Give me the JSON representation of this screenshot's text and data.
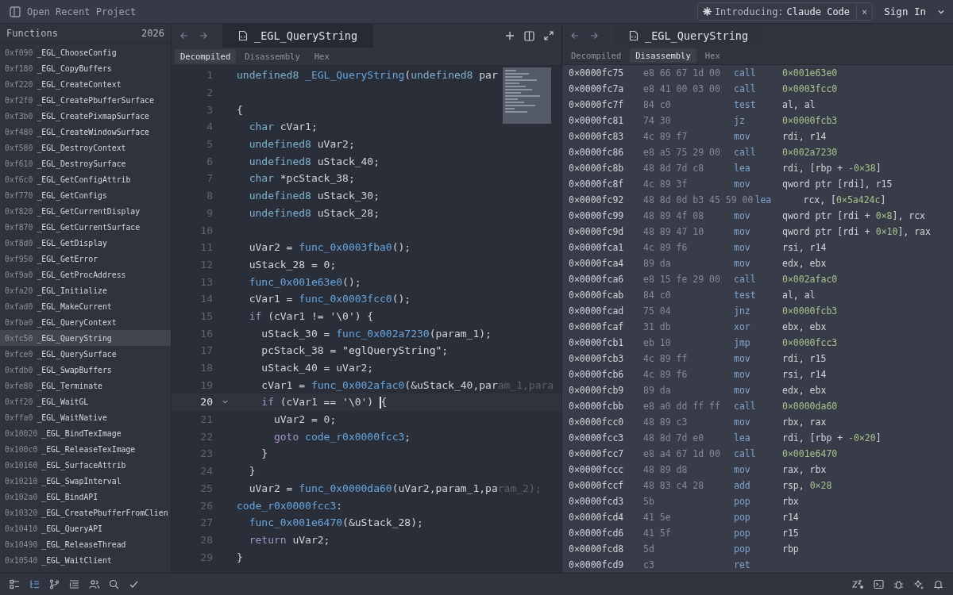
{
  "top_bar": {
    "title": "Open Recent Project",
    "banner": {
      "prefix": "Introducing:",
      "name": "Claude Code",
      "close": "×"
    },
    "sign_in": "Sign In"
  },
  "sidebar": {
    "title": "Functions",
    "count": "2026",
    "items": [
      {
        "address": "0xf090",
        "name": "_EGL_ChooseConfig",
        "selected": false
      },
      {
        "address": "0xf180",
        "name": "_EGL_CopyBuffers",
        "selected": false
      },
      {
        "address": "0xf220",
        "name": "_EGL_CreateContext",
        "selected": false
      },
      {
        "address": "0xf2f0",
        "name": "_EGL_CreatePbufferSurface",
        "selected": false
      },
      {
        "address": "0xf3b0",
        "name": "_EGL_CreatePixmapSurface",
        "selected": false
      },
      {
        "address": "0xf480",
        "name": "_EGL_CreateWindowSurface",
        "selected": false
      },
      {
        "address": "0xf580",
        "name": "_EGL_DestroyContext",
        "selected": false
      },
      {
        "address": "0xf610",
        "name": "_EGL_DestroySurface",
        "selected": false
      },
      {
        "address": "0xf6c0",
        "name": "_EGL_GetConfigAttrib",
        "selected": false
      },
      {
        "address": "0xf770",
        "name": "_EGL_GetConfigs",
        "selected": false
      },
      {
        "address": "0xf820",
        "name": "_EGL_GetCurrentDisplay",
        "selected": false
      },
      {
        "address": "0xf870",
        "name": "_EGL_GetCurrentSurface",
        "selected": false
      },
      {
        "address": "0xf8d0",
        "name": "_EGL_GetDisplay",
        "selected": false
      },
      {
        "address": "0xf950",
        "name": "_EGL_GetError",
        "selected": false
      },
      {
        "address": "0xf9a0",
        "name": "_EGL_GetProcAddress",
        "selected": false
      },
      {
        "address": "0xfa20",
        "name": "_EGL_Initialize",
        "selected": false
      },
      {
        "address": "0xfad0",
        "name": "_EGL_MakeCurrent",
        "selected": false
      },
      {
        "address": "0xfba0",
        "name": "_EGL_QueryContext",
        "selected": false
      },
      {
        "address": "0xfc50",
        "name": "_EGL_QueryString",
        "selected": true
      },
      {
        "address": "0xfce0",
        "name": "_EGL_QuerySurface",
        "selected": false
      },
      {
        "address": "0xfdb0",
        "name": "_EGL_SwapBuffers",
        "selected": false
      },
      {
        "address": "0xfe80",
        "name": "_EGL_Terminate",
        "selected": false
      },
      {
        "address": "0xff20",
        "name": "_EGL_WaitGL",
        "selected": false
      },
      {
        "address": "0xffa0",
        "name": "_EGL_WaitNative",
        "selected": false
      },
      {
        "address": "0x10020",
        "name": "_EGL_BindTexImage",
        "selected": false
      },
      {
        "address": "0x100c0",
        "name": "_EGL_ReleaseTexImage",
        "selected": false
      },
      {
        "address": "0x10160",
        "name": "_EGL_SurfaceAttrib",
        "selected": false
      },
      {
        "address": "0x10210",
        "name": "_EGL_SwapInterval",
        "selected": false
      },
      {
        "address": "0x102a0",
        "name": "_EGL_BindAPI",
        "selected": false
      },
      {
        "address": "0x10320",
        "name": "_EGL_CreatePbufferFromClien",
        "selected": false
      },
      {
        "address": "0x10410",
        "name": "_EGL_QueryAPI",
        "selected": false
      },
      {
        "address": "0x10490",
        "name": "_EGL_ReleaseThread",
        "selected": false
      },
      {
        "address": "0x10540",
        "name": "_EGL_WaitClient",
        "selected": false
      }
    ]
  },
  "left_pane": {
    "tab_title": "_EGL_QueryString",
    "view_tabs": [
      {
        "label": "Decompiled",
        "selected": true
      },
      {
        "label": "Disassembly",
        "selected": false
      },
      {
        "label": "Hex",
        "selected": false
      }
    ],
    "code_lines": [
      {
        "number": "1",
        "current": false,
        "tokens": [
          {
            "kind": "type",
            "text": "undefined8"
          },
          {
            "kind": "function",
            "text": " _EGL_QueryString"
          },
          {
            "kind": "plain",
            "text": "("
          },
          {
            "kind": "type",
            "text": "undefined8"
          },
          {
            "kind": "plain",
            "text": " par"
          }
        ]
      },
      {
        "number": "2",
        "current": false
      },
      {
        "number": "3",
        "current": false,
        "tokens": [
          {
            "kind": "plain",
            "text": "{"
          }
        ]
      },
      {
        "number": "4",
        "current": false,
        "tokens": [
          {
            "kind": "type",
            "text": "  char"
          },
          {
            "kind": "plain",
            "text": " cVar1;"
          }
        ]
      },
      {
        "number": "5",
        "current": false,
        "tokens": [
          {
            "kind": "type",
            "text": "  undefined8"
          },
          {
            "kind": "plain",
            "text": " uVar2;"
          }
        ]
      },
      {
        "number": "6",
        "current": false,
        "tokens": [
          {
            "kind": "type",
            "text": "  undefined8"
          },
          {
            "kind": "plain",
            "text": " uStack_40;"
          }
        ]
      },
      {
        "number": "7",
        "current": false,
        "tokens": [
          {
            "kind": "type",
            "text": "  char"
          },
          {
            "kind": "plain",
            "text": " *pcStack_38;"
          }
        ]
      },
      {
        "number": "8",
        "current": false,
        "tokens": [
          {
            "kind": "type",
            "text": "  undefined8"
          },
          {
            "kind": "plain",
            "text": " uStack_30;"
          }
        ]
      },
      {
        "number": "9",
        "current": false,
        "tokens": [
          {
            "kind": "type",
            "text": "  undefined8"
          },
          {
            "kind": "plain",
            "text": " uStack_28;"
          }
        ]
      },
      {
        "number": "10",
        "current": false
      },
      {
        "number": "11",
        "current": false,
        "tokens": [
          {
            "kind": "plain",
            "text": "  uVar2 = "
          },
          {
            "kind": "function",
            "text": "func_0x0003fba0"
          },
          {
            "kind": "plain",
            "text": "();"
          }
        ]
      },
      {
        "number": "12",
        "current": false,
        "tokens": [
          {
            "kind": "plain",
            "text": "  uStack_28 = 0;"
          }
        ]
      },
      {
        "number": "13",
        "current": false,
        "tokens": [
          {
            "kind": "function",
            "text": "  func_0x001e63e0"
          },
          {
            "kind": "plain",
            "text": "();"
          }
        ]
      },
      {
        "number": "14",
        "current": false,
        "tokens": [
          {
            "kind": "plain",
            "text": "  cVar1 = "
          },
          {
            "kind": "function",
            "text": "func_0x0003fcc0"
          },
          {
            "kind": "plain",
            "text": "();"
          }
        ]
      },
      {
        "number": "15",
        "current": false,
        "tokens": [
          {
            "kind": "keyword",
            "text": "  if"
          },
          {
            "kind": "plain",
            "text": " (cVar1 != '\\0') {"
          }
        ]
      },
      {
        "number": "16",
        "current": false,
        "tokens": [
          {
            "kind": "plain",
            "text": "    uStack_30 = "
          },
          {
            "kind": "function",
            "text": "func_0x002a7230"
          },
          {
            "kind": "plain",
            "text": "(param_1);"
          }
        ]
      },
      {
        "number": "17",
        "current": false,
        "tokens": [
          {
            "kind": "plain",
            "text": "    pcStack_38 = "
          },
          {
            "kind": "string",
            "text": "\"eglQueryString\""
          },
          {
            "kind": "plain",
            "text": ";"
          }
        ]
      },
      {
        "number": "18",
        "current": false,
        "tokens": [
          {
            "kind": "plain",
            "text": "    uStack_40 = uVar2;"
          }
        ]
      },
      {
        "number": "19",
        "current": false,
        "tokens": [
          {
            "kind": "plain",
            "text": "    cVar1 = "
          },
          {
            "kind": "function",
            "text": "func_0x002afac0"
          },
          {
            "kind": "plain",
            "text": "(&uStack_40,par"
          },
          {
            "kind": "faded",
            "text": "am_1,para"
          }
        ]
      },
      {
        "number": "20",
        "current": true,
        "tokens": [
          {
            "kind": "keyword",
            "text": "    if"
          },
          {
            "kind": "plain",
            "text": " (cVar1 == '\\0') "
          },
          {
            "kind": "plain",
            "text": "{"
          }
        ]
      },
      {
        "number": "21",
        "current": false,
        "tokens": [
          {
            "kind": "plain",
            "text": "      uVar2 = 0;"
          }
        ]
      },
      {
        "number": "22",
        "current": false,
        "tokens": [
          {
            "kind": "keyword",
            "text": "      goto"
          },
          {
            "kind": "function",
            "text": " code_r0x0000fcc3"
          },
          {
            "kind": "plain",
            "text": ";"
          }
        ]
      },
      {
        "number": "23",
        "current": false,
        "tokens": [
          {
            "kind": "plain",
            "text": "    }"
          }
        ]
      },
      {
        "number": "24",
        "current": false,
        "tokens": [
          {
            "kind": "plain",
            "text": "  }"
          }
        ]
      },
      {
        "number": "25",
        "current": false,
        "tokens": [
          {
            "kind": "plain",
            "text": "  uVar2 = "
          },
          {
            "kind": "function",
            "text": "func_0x0000da60"
          },
          {
            "kind": "plain",
            "text": "(uVar2,param_1,pa"
          },
          {
            "kind": "faded",
            "text": "ram_2);"
          }
        ]
      },
      {
        "number": "26",
        "current": false,
        "tokens": [
          {
            "kind": "function",
            "text": "code_r0x0000fcc3"
          },
          {
            "kind": "plain",
            "text": ":"
          }
        ]
      },
      {
        "number": "27",
        "current": false,
        "tokens": [
          {
            "kind": "function",
            "text": "  func_0x001e6470"
          },
          {
            "kind": "plain",
            "text": "(&uStack_28);"
          }
        ]
      },
      {
        "number": "28",
        "current": false,
        "tokens": [
          {
            "kind": "keyword",
            "text": "  return"
          },
          {
            "kind": "plain",
            "text": " uVar2;"
          }
        ]
      },
      {
        "number": "29",
        "current": false,
        "tokens": [
          {
            "kind": "plain",
            "text": "}"
          }
        ]
      }
    ]
  },
  "right_pane": {
    "tab_title": "_EGL_QueryString",
    "view_tabs": [
      {
        "label": "Decompiled",
        "selected": false
      },
      {
        "label": "Disassembly",
        "selected": true
      },
      {
        "label": "Hex",
        "selected": false
      }
    ],
    "rows": [
      {
        "address": "0×0000fc75",
        "bytes": "e8 66 67 1d 00",
        "mnemonic": "call",
        "operands": [
          {
            "kind": "number",
            "text": "0×001e63e0"
          }
        ]
      },
      {
        "address": "0×0000fc7a",
        "bytes": "e8 41 00 03 00",
        "mnemonic": "call",
        "operands": [
          {
            "kind": "number",
            "text": "0×0003fcc0"
          }
        ]
      },
      {
        "address": "0×0000fc7f",
        "bytes": "84 c0",
        "mnemonic": "test",
        "operands": [
          {
            "kind": "plain",
            "text": "al, al"
          }
        ]
      },
      {
        "address": "0×0000fc81",
        "bytes": "74 30",
        "mnemonic": "jz",
        "operands": [
          {
            "kind": "number",
            "text": "0×0000fcb3"
          }
        ]
      },
      {
        "address": "0×0000fc83",
        "bytes": "4c 89 f7",
        "mnemonic": "mov",
        "operands": [
          {
            "kind": "plain",
            "text": "rdi, r14"
          }
        ]
      },
      {
        "address": "0×0000fc86",
        "bytes": "e8 a5 75 29 00",
        "mnemonic": "call",
        "operands": [
          {
            "kind": "number",
            "text": "0×002a7230"
          }
        ]
      },
      {
        "address": "0×0000fc8b",
        "bytes": "48 8d 7d c8",
        "mnemonic": "lea",
        "operands": [
          {
            "kind": "plain",
            "text": "rdi, [rbp + "
          },
          {
            "kind": "number",
            "text": "-0×38"
          },
          {
            "kind": "plain",
            "text": "]"
          }
        ]
      },
      {
        "address": "0×0000fc8f",
        "bytes": "4c 89 3f",
        "mnemonic": "mov",
        "operands": [
          {
            "kind": "plain",
            "text": "qword ptr [rdi], r15"
          }
        ]
      },
      {
        "address": "0×0000fc92",
        "bytes": "48 8d 0d b3 45 59 00",
        "mnemonic": "lea",
        "operands": [
          {
            "kind": "plain",
            "text": "rcx, ["
          },
          {
            "kind": "number",
            "text": "0×5a424c"
          },
          {
            "kind": "plain",
            "text": "]"
          }
        ]
      },
      {
        "address": "0×0000fc99",
        "bytes": "48 89 4f 08",
        "mnemonic": "mov",
        "operands": [
          {
            "kind": "plain",
            "text": "qword ptr [rdi + "
          },
          {
            "kind": "number",
            "text": "0×8"
          },
          {
            "kind": "plain",
            "text": "], rcx"
          }
        ]
      },
      {
        "address": "0×0000fc9d",
        "bytes": "48 89 47 10",
        "mnemonic": "mov",
        "operands": [
          {
            "kind": "plain",
            "text": "qword ptr [rdi + "
          },
          {
            "kind": "number",
            "text": "0×10"
          },
          {
            "kind": "plain",
            "text": "], rax"
          }
        ]
      },
      {
        "address": "0×0000fca1",
        "bytes": "4c 89 f6",
        "mnemonic": "mov",
        "operands": [
          {
            "kind": "plain",
            "text": "rsi, r14"
          }
        ]
      },
      {
        "address": "0×0000fca4",
        "bytes": "89 da",
        "mnemonic": "mov",
        "operands": [
          {
            "kind": "plain",
            "text": "edx, ebx"
          }
        ]
      },
      {
        "address": "0×0000fca6",
        "bytes": "e8 15 fe 29 00",
        "mnemonic": "call",
        "operands": [
          {
            "kind": "number",
            "text": "0×002afac0"
          }
        ]
      },
      {
        "address": "0×0000fcab",
        "bytes": "84 c0",
        "mnemonic": "test",
        "operands": [
          {
            "kind": "plain",
            "text": "al, al"
          }
        ]
      },
      {
        "address": "0×0000fcad",
        "bytes": "75 04",
        "mnemonic": "jnz",
        "operands": [
          {
            "kind": "number",
            "text": "0×0000fcb3"
          }
        ]
      },
      {
        "address": "0×0000fcaf",
        "bytes": "31 db",
        "mnemonic": "xor",
        "operands": [
          {
            "kind": "plain",
            "text": "ebx, ebx"
          }
        ]
      },
      {
        "address": "0×0000fcb1",
        "bytes": "eb 10",
        "mnemonic": "jmp",
        "operands": [
          {
            "kind": "number",
            "text": "0×0000fcc3"
          }
        ]
      },
      {
        "address": "0×0000fcb3",
        "bytes": "4c 89 ff",
        "mnemonic": "mov",
        "operands": [
          {
            "kind": "plain",
            "text": "rdi, r15"
          }
        ]
      },
      {
        "address": "0×0000fcb6",
        "bytes": "4c 89 f6",
        "mnemonic": "mov",
        "operands": [
          {
            "kind": "plain",
            "text": "rsi, r14"
          }
        ]
      },
      {
        "address": "0×0000fcb9",
        "bytes": "89 da",
        "mnemonic": "mov",
        "operands": [
          {
            "kind": "plain",
            "text": "edx, ebx"
          }
        ]
      },
      {
        "address": "0×0000fcbb",
        "bytes": "e8 a0 dd ff ff",
        "mnemonic": "call",
        "operands": [
          {
            "kind": "number",
            "text": "0×0000da60"
          }
        ]
      },
      {
        "address": "0×0000fcc0",
        "bytes": "48 89 c3",
        "mnemonic": "mov",
        "operands": [
          {
            "kind": "plain",
            "text": "rbx, rax"
          }
        ]
      },
      {
        "address": "0×0000fcc3",
        "bytes": "48 8d 7d e0",
        "mnemonic": "lea",
        "operands": [
          {
            "kind": "plain",
            "text": "rdi, [rbp + "
          },
          {
            "kind": "number",
            "text": "-0×20"
          },
          {
            "kind": "plain",
            "text": "]"
          }
        ]
      },
      {
        "address": "0×0000fcc7",
        "bytes": "e8 a4 67 1d 00",
        "mnemonic": "call",
        "operands": [
          {
            "kind": "number",
            "text": "0×001e6470"
          }
        ]
      },
      {
        "address": "0×0000fccc",
        "bytes": "48 89 d8",
        "mnemonic": "mov",
        "operands": [
          {
            "kind": "plain",
            "text": "rax, rbx"
          }
        ]
      },
      {
        "address": "0×0000fccf",
        "bytes": "48 83 c4 28",
        "mnemonic": "add",
        "operands": [
          {
            "kind": "plain",
            "text": "rsp, "
          },
          {
            "kind": "number",
            "text": "0×28"
          }
        ]
      },
      {
        "address": "0×0000fcd3",
        "bytes": "5b",
        "mnemonic": "pop",
        "operands": [
          {
            "kind": "plain",
            "text": "rbx"
          }
        ]
      },
      {
        "address": "0×0000fcd4",
        "bytes": "41 5e",
        "mnemonic": "pop",
        "operands": [
          {
            "kind": "plain",
            "text": "r14"
          }
        ]
      },
      {
        "address": "0×0000fcd6",
        "bytes": "41 5f",
        "mnemonic": "pop",
        "operands": [
          {
            "kind": "plain",
            "text": "r15"
          }
        ]
      },
      {
        "address": "0×0000fcd8",
        "bytes": "5d",
        "mnemonic": "pop",
        "operands": [
          {
            "kind": "plain",
            "text": "rbp"
          }
        ]
      },
      {
        "address": "0×0000fcd9",
        "bytes": "c3",
        "mnemonic": "ret"
      }
    ]
  },
  "bottom_bar": {
    "left_tools": [
      {
        "selected": false
      },
      {
        "selected": true
      },
      {
        "selected": false
      },
      {
        "selected": false
      },
      {
        "selected": false
      },
      {
        "selected": false
      },
      {
        "selected": false
      }
    ]
  }
}
